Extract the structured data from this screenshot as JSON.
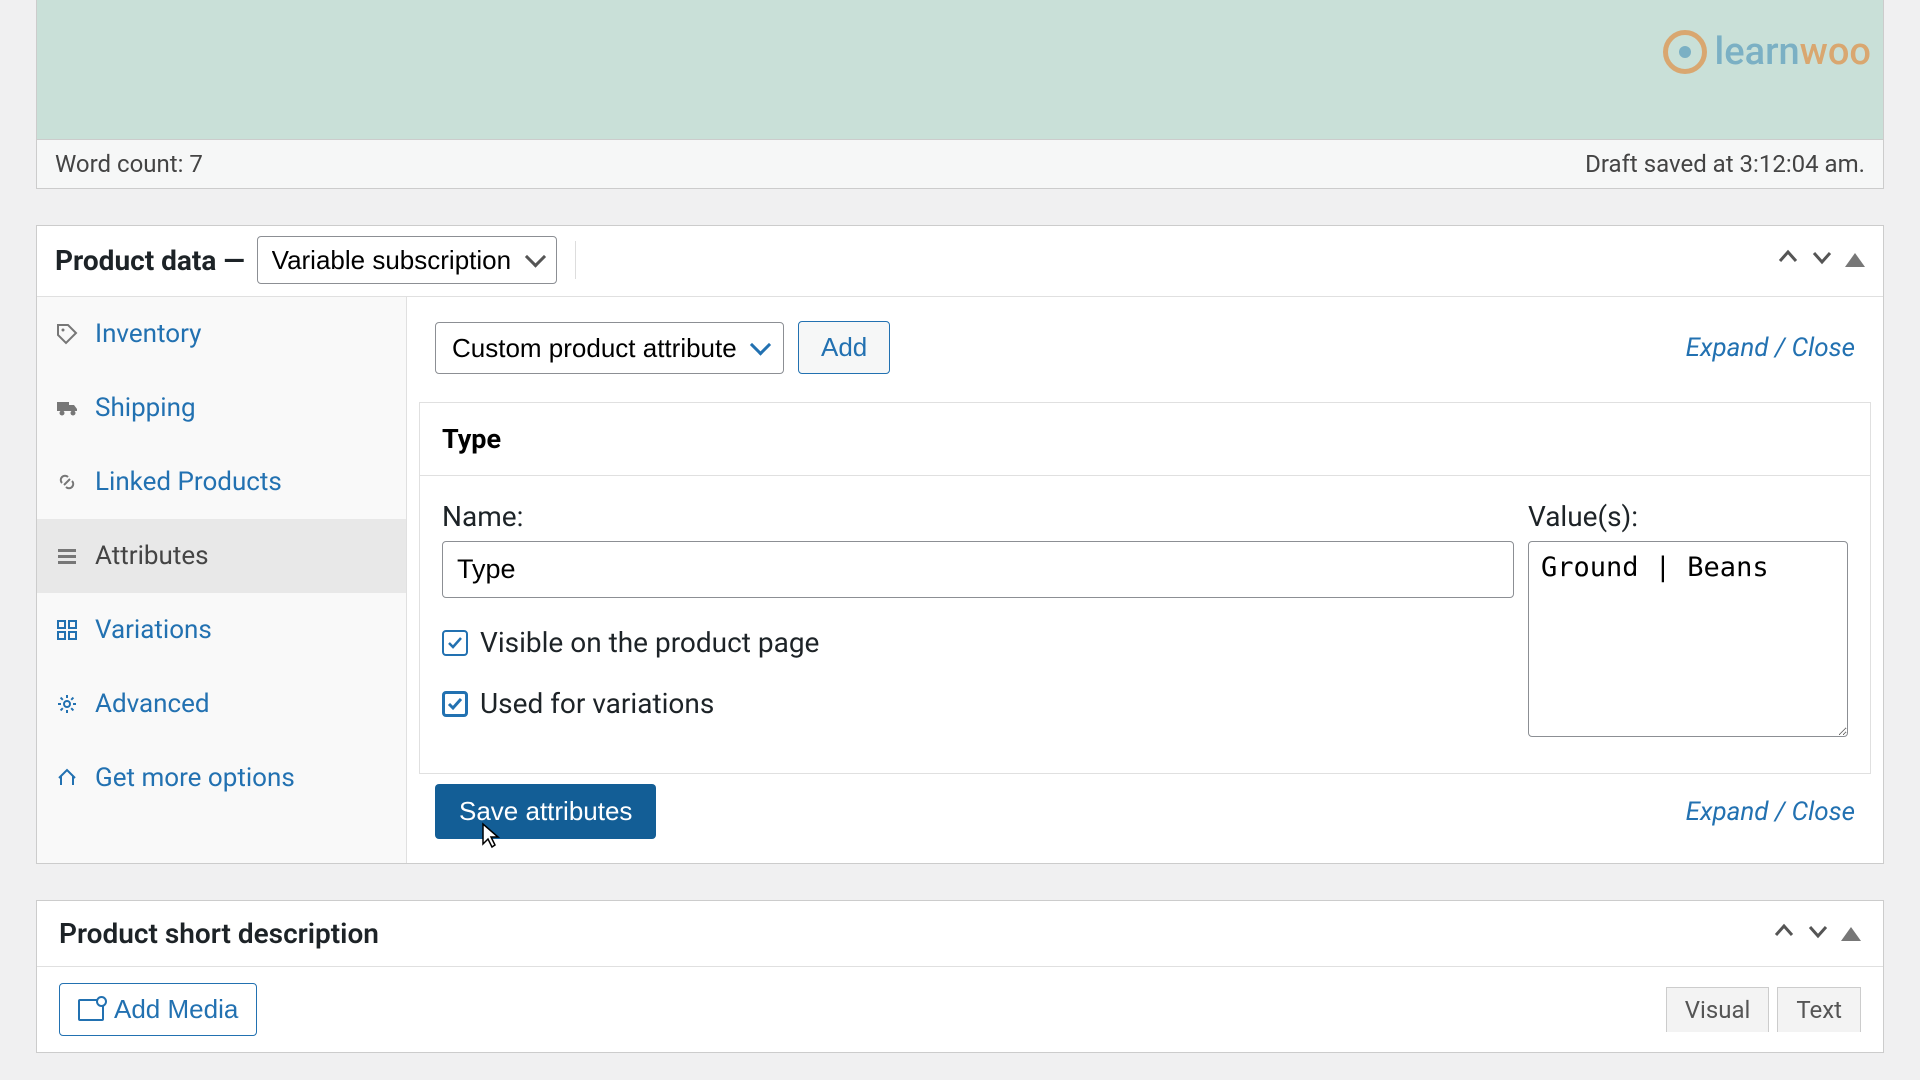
{
  "logo": {
    "text1": "learn",
    "text2": "woo"
  },
  "status": {
    "wordcount_label": "Word count: 7",
    "draft_saved": "Draft saved at 3:12:04 am."
  },
  "product_data": {
    "title": "Product data —",
    "type_select": "Variable subscription"
  },
  "tabs": {
    "inventory": "Inventory",
    "shipping": "Shipping",
    "linked": "Linked Products",
    "attributes": "Attributes",
    "variations": "Variations",
    "advanced": "Advanced",
    "get_more": "Get more options"
  },
  "attr": {
    "selector": "Custom product attribute",
    "add": "Add",
    "expand": "Expand / Close",
    "header": "Type",
    "name_label": "Name:",
    "name_value": "Type",
    "values_label": "Value(s):",
    "values_value": "Ground | Beans",
    "visible_label": "Visible on the product page",
    "used_label": "Used for variations",
    "save": "Save attributes"
  },
  "desc": {
    "title": "Product short description",
    "add_media": "Add Media",
    "visual": "Visual",
    "text": "Text"
  }
}
